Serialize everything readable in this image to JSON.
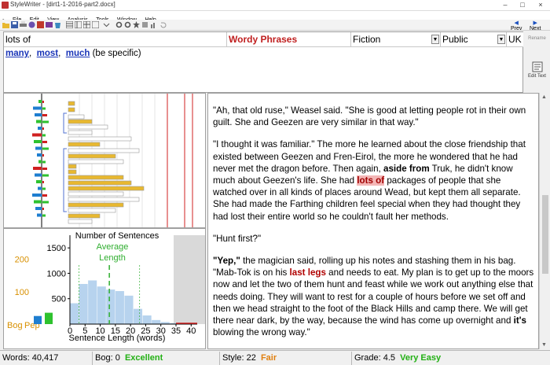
{
  "window": {
    "title": "StyleWriter - [dirt1-1-2016-part2.docx]",
    "min_glyph": "–",
    "max_glyph": "□",
    "close_glyph": "×"
  },
  "menu": [
    "File",
    "Edit",
    "View",
    "Analysis",
    "Tools",
    "Window",
    "Help"
  ],
  "nav": {
    "prev": "Prev",
    "next": "Next"
  },
  "issue": {
    "phrase": "lots of",
    "category": "Wordy Phrases",
    "genre": "Fiction",
    "audience": "Public",
    "locale": "UK",
    "suggestions": [
      "many",
      "most",
      "much"
    ],
    "suggestion_note": "(be specific)",
    "sep": ","
  },
  "buttons": {
    "rename": "Rename",
    "edit_text": "Edit Text"
  },
  "histogram": {
    "chart_data": {
      "type": "bar",
      "title": "Number of Sentences",
      "xlabel": "Sentence Length (words)",
      "ylabel": "",
      "x_ticks": [
        0,
        5,
        10,
        15,
        20,
        25,
        30,
        35,
        40
      ],
      "y_ticks": [
        500,
        1000,
        1500
      ],
      "ylim": [
        0,
        1750
      ],
      "xlim": [
        0,
        42
      ],
      "bin_width": 3,
      "bins_start": [
        0,
        3,
        6,
        9,
        12,
        15,
        18,
        21,
        24,
        27,
        30,
        33
      ],
      "values": [
        410,
        790,
        860,
        740,
        680,
        650,
        560,
        300,
        170,
        80,
        40,
        20
      ],
      "average": 13,
      "average_label_1": "Average",
      "average_label_2": "Length",
      "grey_region_start": 35,
      "bar_color": "#b7d3ee",
      "avg_color": "#2fae2f"
    },
    "bogpep": {
      "ticks": [
        100,
        200
      ],
      "tick_labels": [
        "100",
        "200"
      ],
      "labels": [
        "Bog",
        "Pep"
      ],
      "values": [
        25,
        35
      ],
      "colors": [
        "#1e7ed0",
        "#2ec22e"
      ],
      "ylim": [
        0,
        250
      ]
    }
  },
  "document": {
    "paragraphs": [
      [
        {
          "t": "\"Ah, that old ruse,\" Weasel said.  \"She is good at letting people rot in their own guilt.  She and Geezen are very similar in that way.\""
        }
      ],
      [
        {
          "t": "\"I thought it was familiar.\"  The more he learned about the close friendship that existed between Geezen and Fren-Eirol, the more he wondered that he had never met the dragon before.  Then again, "
        },
        {
          "t": "aside from",
          "s": "b"
        },
        {
          "t": " Truk, he didn't know much about Geezen's life.  She had "
        },
        {
          "t": "lots of",
          "s": "hl"
        },
        {
          "t": " packages of people that she watched over in all kinds of places around Wead, but kept them all separate.  She had made the Farthing children feel special when they had thought they had lost their entire world so he couldn't fault her methods."
        }
      ],
      [
        {
          "t": "\"Hunt first?\""
        }
      ],
      [
        {
          "t": "\"Yep,\"",
          "s": "b"
        },
        {
          "t": " the magician said, rolling up his notes and stashing them in his bag.  \"Mab-Tok is on his "
        },
        {
          "t": "last legs",
          "s": "red"
        },
        {
          "t": " and needs to eat.  My plan is to get up to the moors now and let the two of them hunt and feast while we work out anything else that needs doing.  They will want to rest for a couple of hours before we set off and then we head straight to the foot of the Black Hills and camp there.  We will get there near dark, by the way, because the wind has come up overnight and "
        },
        {
          "t": "it's",
          "s": "b"
        },
        {
          "t": " blowing the wrong way.\""
        }
      ]
    ]
  },
  "status": {
    "words_label": "Words:",
    "words": "40,417",
    "bog_label": "Bog:",
    "bog": "0",
    "bog_rating": "Excellent",
    "style_label": "Style:",
    "style": "22",
    "style_rating": "Fair",
    "grade_label": "Grade:",
    "grade": "4.5",
    "grade_rating": "Very Easy"
  }
}
